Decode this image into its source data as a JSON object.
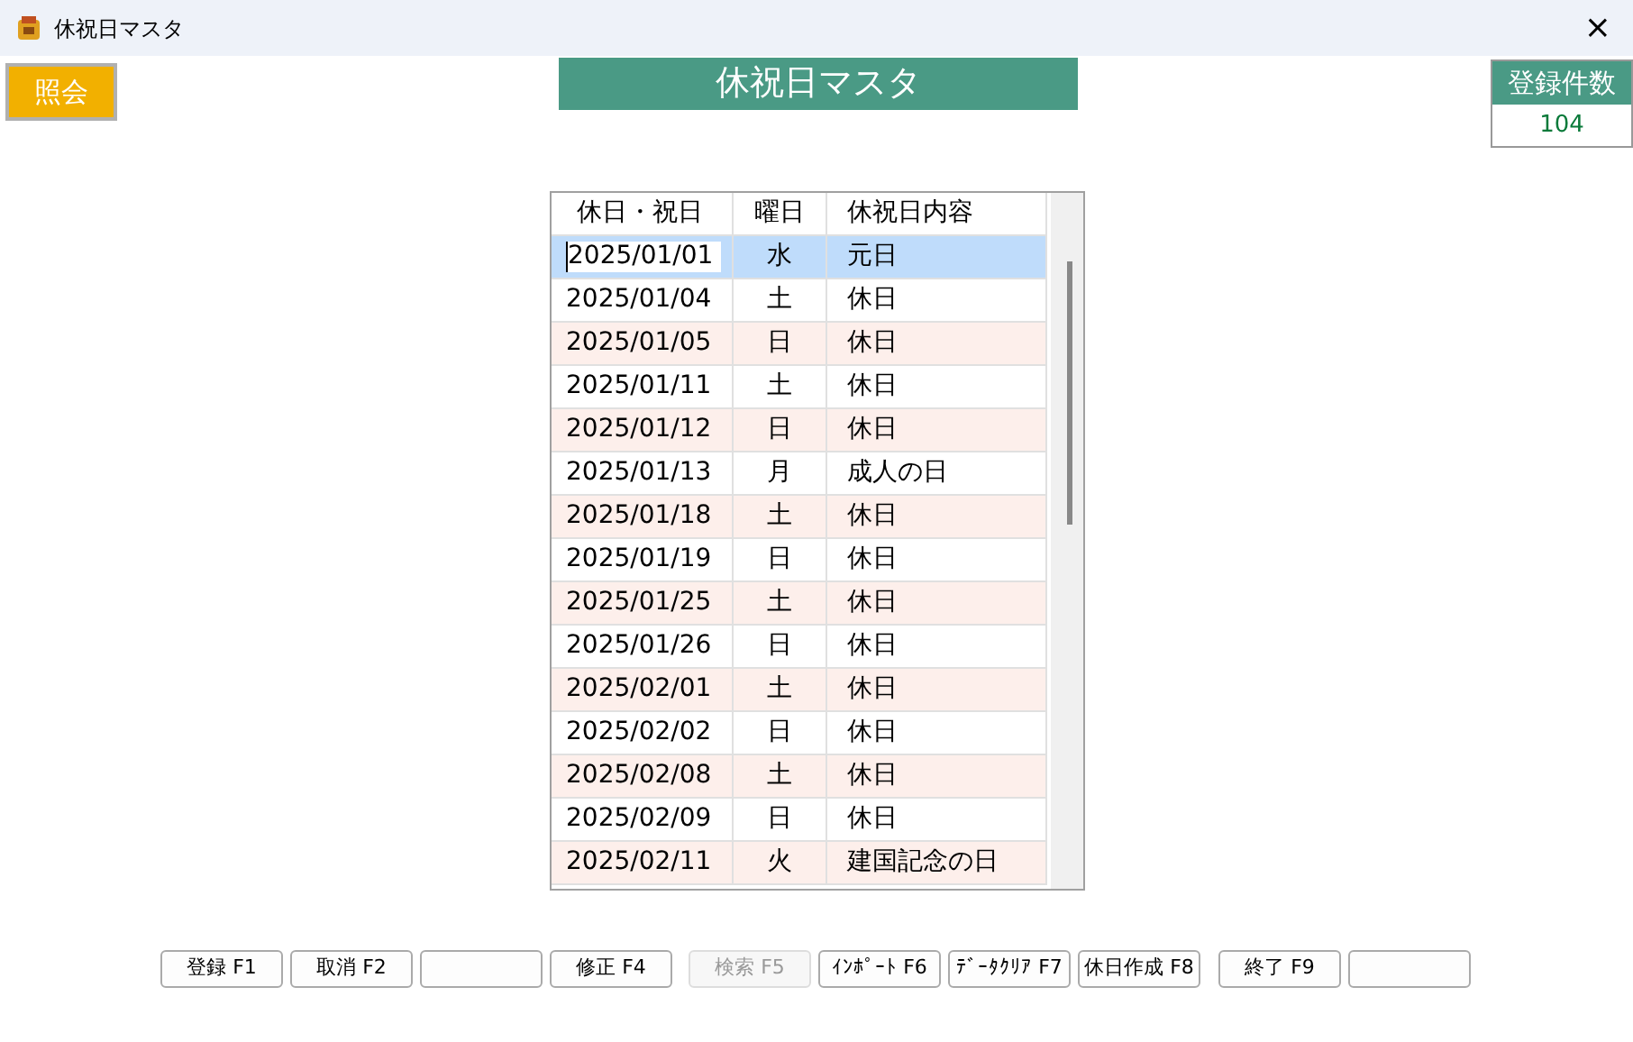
{
  "window": {
    "title": "休祝日マスタ",
    "close": "×"
  },
  "mode_button": {
    "label": "照会"
  },
  "screen_title": "休祝日マスタ",
  "count": {
    "label": "登録件数",
    "value": "104"
  },
  "table": {
    "columns": [
      "休日・祝日",
      "曜日",
      "休祝日内容"
    ],
    "rows": [
      {
        "date": "2025/01/01",
        "weekday": "水",
        "content": "元日",
        "selected": true
      },
      {
        "date": "2025/01/04",
        "weekday": "土",
        "content": "休日",
        "selected": false
      },
      {
        "date": "2025/01/05",
        "weekday": "日",
        "content": "休日",
        "selected": false
      },
      {
        "date": "2025/01/11",
        "weekday": "土",
        "content": "休日",
        "selected": false
      },
      {
        "date": "2025/01/12",
        "weekday": "日",
        "content": "休日",
        "selected": false
      },
      {
        "date": "2025/01/13",
        "weekday": "月",
        "content": "成人の日",
        "selected": false
      },
      {
        "date": "2025/01/18",
        "weekday": "土",
        "content": "休日",
        "selected": false
      },
      {
        "date": "2025/01/19",
        "weekday": "日",
        "content": "休日",
        "selected": false
      },
      {
        "date": "2025/01/25",
        "weekday": "土",
        "content": "休日",
        "selected": false
      },
      {
        "date": "2025/01/26",
        "weekday": "日",
        "content": "休日",
        "selected": false
      },
      {
        "date": "2025/02/01",
        "weekday": "土",
        "content": "休日",
        "selected": false
      },
      {
        "date": "2025/02/02",
        "weekday": "日",
        "content": "休日",
        "selected": false
      },
      {
        "date": "2025/02/08",
        "weekday": "土",
        "content": "休日",
        "selected": false
      },
      {
        "date": "2025/02/09",
        "weekday": "日",
        "content": "休日",
        "selected": false
      },
      {
        "date": "2025/02/11",
        "weekday": "火",
        "content": "建国記念の日",
        "selected": false
      }
    ]
  },
  "function_keys": [
    {
      "label": "登録 F1",
      "disabled": false
    },
    {
      "label": "取消 F2",
      "disabled": false
    },
    {
      "disabled": false
    },
    {
      "label": "修正 F4",
      "disabled": false
    },
    {
      "label": "検索 F5",
      "disabled": true
    },
    {
      "label": "ｲﾝﾎﾟｰﾄ F6",
      "disabled": false
    },
    {
      "label": "ﾃﾞｰﾀｸﾘｱ F7",
      "disabled": false
    },
    {
      "label": "休日作成 F8",
      "disabled": false
    },
    {
      "label": "終了 F9",
      "disabled": false
    },
    {
      "disabled": false
    }
  ]
}
